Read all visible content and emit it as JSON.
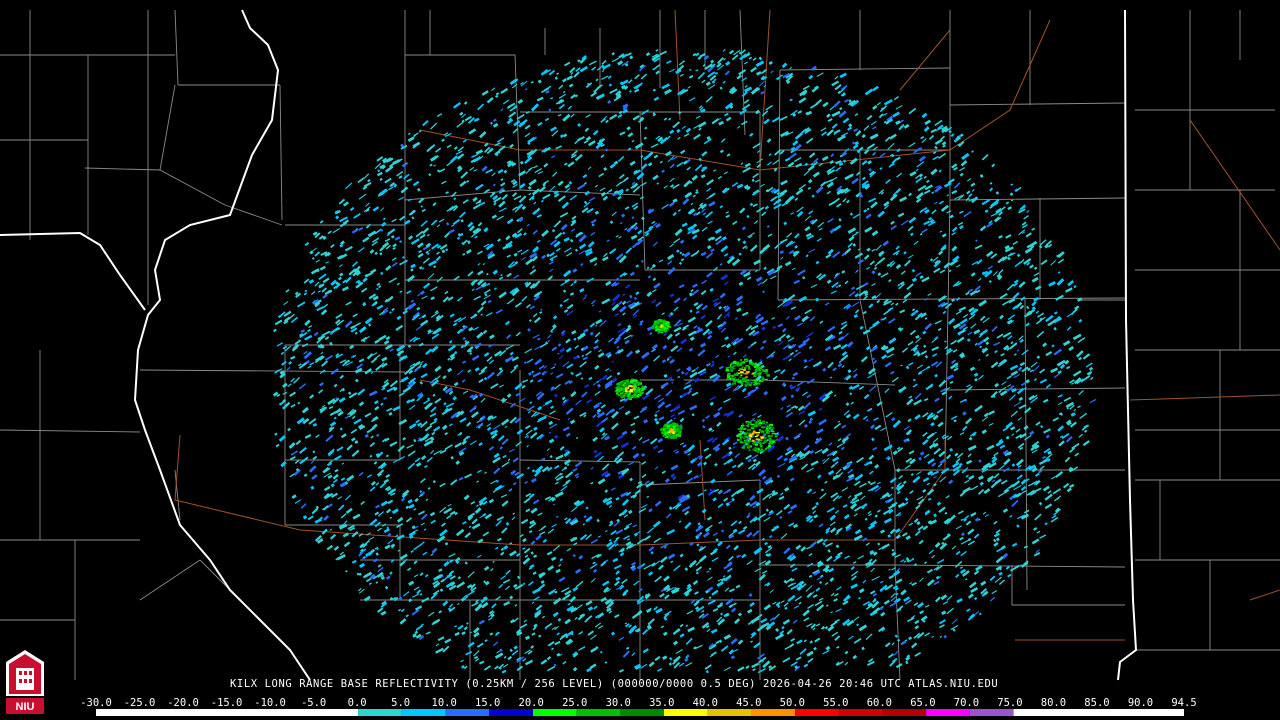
{
  "product_caption": "KILX LONG RANGE BASE REFLECTIVITY (0.25KM / 256 LEVEL) (000000/0000 0.5 DEG) 2026-04-26 20:46 UTC  ATLAS.NIU.EDU",
  "logo_text": "NIU",
  "scale": {
    "labels": [
      "-30.0",
      "-25.0",
      "-20.0",
      "-15.0",
      "-10.0",
      "-5.0",
      "0.0",
      "5.0",
      "10.0",
      "15.0",
      "20.0",
      "25.0",
      "30.0",
      "35.0",
      "40.0",
      "45.0",
      "50.0",
      "55.0",
      "60.0",
      "65.0",
      "70.0",
      "75.0",
      "80.0",
      "85.0",
      "90.0",
      "94.5"
    ],
    "stops": [
      {
        "dbz": -30,
        "color": "#ffffff"
      },
      {
        "dbz": -5,
        "color": "#ffffff"
      },
      {
        "dbz": 0,
        "color": "#2ed3d3"
      },
      {
        "dbz": 5,
        "color": "#00c8ff"
      },
      {
        "dbz": 10,
        "color": "#2a6cff"
      },
      {
        "dbz": 15,
        "color": "#0000d0"
      },
      {
        "dbz": 20,
        "color": "#00ff00"
      },
      {
        "dbz": 25,
        "color": "#00c000"
      },
      {
        "dbz": 30,
        "color": "#008a00"
      },
      {
        "dbz": 35,
        "color": "#ffff00"
      },
      {
        "dbz": 40,
        "color": "#e8c000"
      },
      {
        "dbz": 45,
        "color": "#ff9000"
      },
      {
        "dbz": 50,
        "color": "#ff0000"
      },
      {
        "dbz": 55,
        "color": "#d00000"
      },
      {
        "dbz": 60,
        "color": "#b00000"
      },
      {
        "dbz": 65,
        "color": "#ff00ff"
      },
      {
        "dbz": 70,
        "color": "#9955cc"
      },
      {
        "dbz": 75,
        "color": "#ffffff"
      },
      {
        "dbz": 94.5,
        "color": "#ffffff"
      }
    ]
  },
  "colors": {
    "background": "#000000",
    "county_lines": "#8a8a8a",
    "state_lines": "#ffffff",
    "highways": "#a0522d",
    "radar_site": "#000000"
  }
}
